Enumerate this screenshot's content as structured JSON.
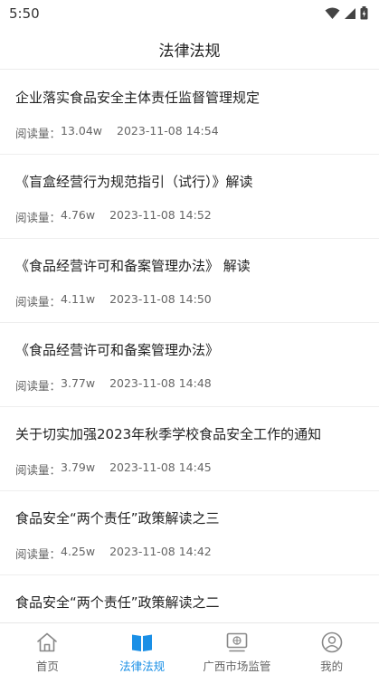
{
  "status_bar": {
    "time": "5:50"
  },
  "header": {
    "title": "法律法规"
  },
  "labels": {
    "read_count_prefix": "阅读量："
  },
  "articles": [
    {
      "title": "企业落实食品安全主体责任监督管理规定",
      "reads": "13.04w",
      "date": "2023-11-08 14:54"
    },
    {
      "title": "《盲盒经营行为规范指引（试行）》解读",
      "reads": "4.76w",
      "date": "2023-11-08 14:52"
    },
    {
      "title": "《食品经营许可和备案管理办法》 解读",
      "reads": "4.11w",
      "date": "2023-11-08 14:50"
    },
    {
      "title": "《食品经营许可和备案管理办法》",
      "reads": "3.77w",
      "date": "2023-11-08 14:48"
    },
    {
      "title": "关于切实加强2023年秋季学校食品安全工作的通知",
      "reads": "3.79w",
      "date": "2023-11-08 14:45"
    },
    {
      "title": "食品安全“两个责任”政策解读之三",
      "reads": "4.25w",
      "date": "2023-11-08 14:42"
    },
    {
      "title": "食品安全“两个责任”政策解读之二",
      "reads": "",
      "date": ""
    }
  ],
  "tabs": [
    {
      "label": "首页",
      "icon": "home-icon",
      "active": false
    },
    {
      "label": "法律法规",
      "icon": "book-icon",
      "active": true
    },
    {
      "label": "广西市场监管",
      "icon": "monitor-icon",
      "active": false
    },
    {
      "label": "我的",
      "icon": "user-icon",
      "active": false
    }
  ],
  "colors": {
    "accent": "#1a8fe6",
    "text": "#222222",
    "muted": "#666666",
    "icon_gray": "#888888"
  }
}
